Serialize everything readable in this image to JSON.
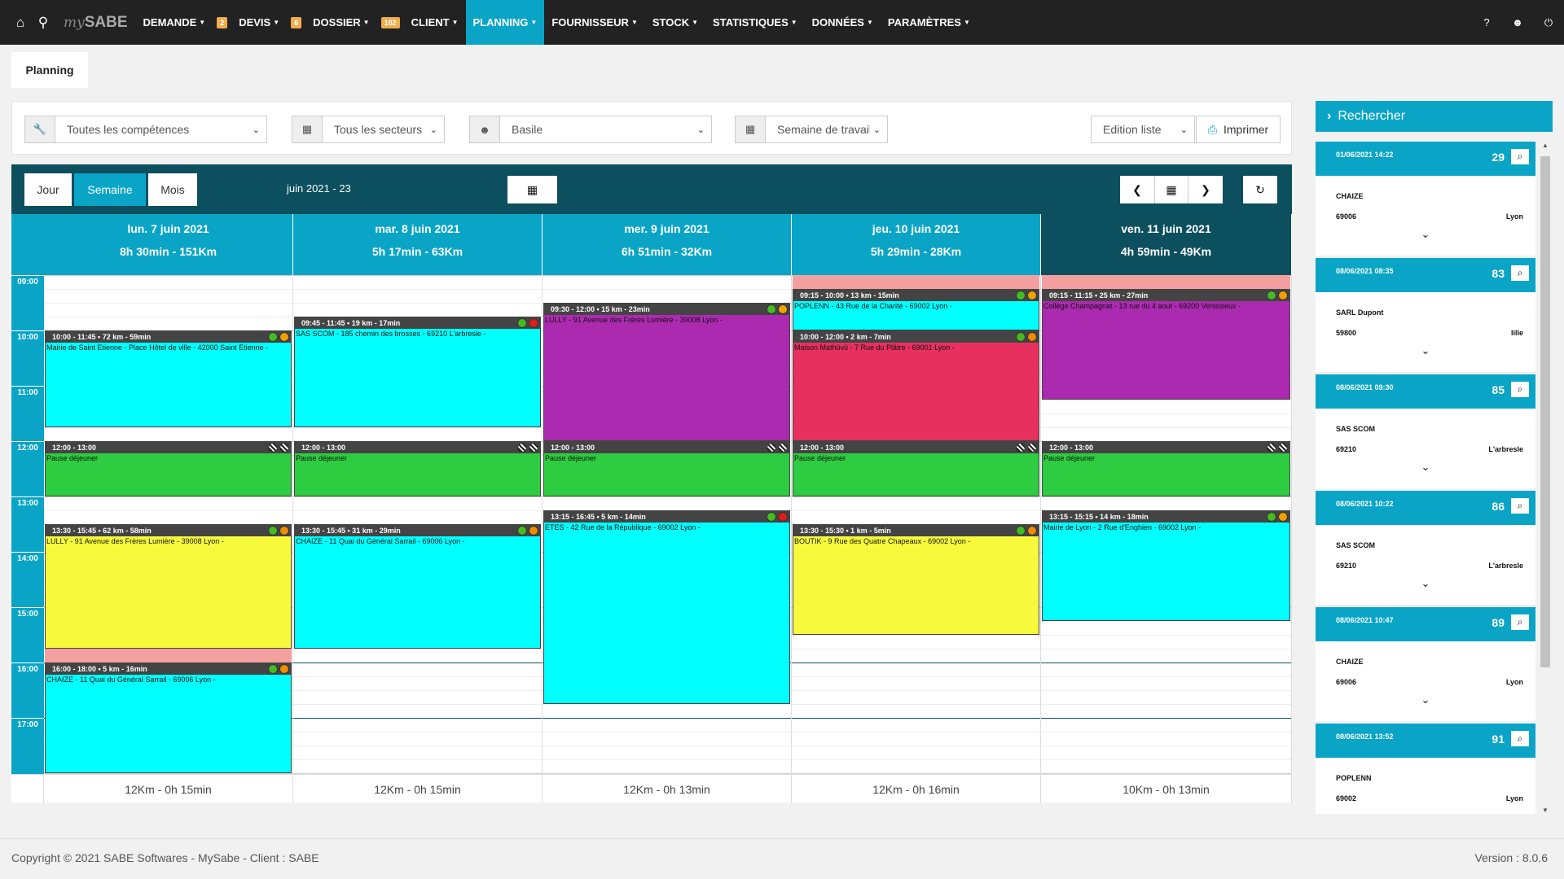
{
  "nav": {
    "logo_prefix": "my",
    "logo_main": "SABE",
    "items": [
      {
        "label": "DEMANDE",
        "badge": "2"
      },
      {
        "label": "DEVIS",
        "badge": "6"
      },
      {
        "label": "DOSSIER",
        "badge": "102"
      },
      {
        "label": "CLIENT",
        "badge": ""
      },
      {
        "label": "PLANNING",
        "badge": "",
        "active": true
      },
      {
        "label": "FOURNISSEUR",
        "badge": ""
      },
      {
        "label": "STOCK",
        "badge": ""
      },
      {
        "label": "STATISTIQUES",
        "badge": ""
      },
      {
        "label": "DONNÉES",
        "badge": ""
      },
      {
        "label": "PARAMÈTRES",
        "badge": ""
      }
    ],
    "right_icons": [
      "help-icon",
      "user-icon",
      "power-icon"
    ],
    "help_label": "?"
  },
  "breadcrumb": "Planning",
  "filters": {
    "competences": "Toutes les compétences",
    "secteurs": "Tous les secteurs",
    "employee": "Basile",
    "period": "Semaine de travail",
    "mode": "Edition liste",
    "print": "Imprimer"
  },
  "toolbar": {
    "views": [
      "Jour",
      "Semaine",
      "Mois"
    ],
    "active_view": "Semaine",
    "title": "juin 2021 - 23"
  },
  "hours": [
    "09:00",
    "10:00",
    "11:00",
    "12:00",
    "13:00",
    "14:00",
    "15:00",
    "16:00",
    "17:00"
  ],
  "days": [
    {
      "name": "lun. 7 juin 2021",
      "summary": "8h 30min - 151Km",
      "footer": "12Km - 0h 15min",
      "color": "#0aa5c6",
      "events": [
        {
          "start": 10.0,
          "end": 11.75,
          "header": "10:00 - 11:45 • 72 km - 59min",
          "body": "Mairie de Saint Etienne - Place Hôtel de ville - 42000 Saint Etienne -",
          "color": "#00ffff",
          "dots": [
            "#44bb22",
            "#f0a000"
          ]
        },
        {
          "start": 12.0,
          "end": 13.0,
          "header": "12:00 - 13:00",
          "body": "Pause déjeuner",
          "color": "#2ecc40",
          "dots": [
            "hatch",
            "hatch"
          ]
        },
        {
          "start": 13.5,
          "end": 15.75,
          "header": "13:30 - 15:45 • 62 km - 58min",
          "body": "LULLY - 91 Avenue des Frères Lumière - 39008 Lyon -",
          "color": "#f7fa3c",
          "dots": [
            "#44bb22",
            "#f08c00"
          ]
        },
        {
          "start": 15.75,
          "end": 16.0,
          "header": "",
          "body": "",
          "color": "#f4a0a0",
          "dots": []
        },
        {
          "start": 16.0,
          "end": 18.0,
          "header": "16:00 - 18:00 • 5 km - 16min",
          "body": "CHAIZE - 11 Quai du Général Sarrail - 69006 Lyon -",
          "color": "#00ffff",
          "dots": [
            "#44bb22",
            "#f08c00"
          ]
        }
      ]
    },
    {
      "name": "mar. 8 juin 2021",
      "summary": "5h 17min - 63Km",
      "footer": "12Km - 0h 15min",
      "color": "#0aa5c6",
      "events": [
        {
          "start": 9.75,
          "end": 11.75,
          "header": "09:45 - 11:45 • 19 km - 17min",
          "body": "SAS SCOM - 185 chemin des brosses - 69210 L'arbresle -",
          "color": "#00ffff",
          "dots": [
            "#44bb22",
            "#e21b1b"
          ]
        },
        {
          "start": 12.0,
          "end": 13.0,
          "header": "12:00 - 13:00",
          "body": "Pause déjeuner",
          "color": "#2ecc40",
          "dots": [
            "hatch",
            "hatch"
          ]
        },
        {
          "start": 13.5,
          "end": 15.75,
          "header": "13:30 - 15:45 • 31 km - 29min",
          "body": "CHAIZE - 11 Quai du Général Sarrail - 69006 Lyon -",
          "color": "#00ffff",
          "dots": [
            "#44bb22",
            "#f08c00"
          ]
        }
      ]
    },
    {
      "name": "mer. 9 juin 2021",
      "summary": "6h 51min - 32Km",
      "footer": "12Km - 0h 13min",
      "color": "#0aa5c6",
      "events": [
        {
          "start": 9.5,
          "end": 12.0,
          "header": "09:30 - 12:00 • 15 km - 23min",
          "body": "LULLY - 91 Avenue des Frères Lumière - 39008 Lyon -",
          "color": "#ac2ab0",
          "dots": [
            "#44bb22",
            "#f0a000"
          ]
        },
        {
          "start": 12.0,
          "end": 13.0,
          "header": "12:00 - 13:00",
          "body": "Pause déjeuner",
          "color": "#2ecc40",
          "dots": [
            "hatch",
            "hatch"
          ]
        },
        {
          "start": 13.25,
          "end": 16.75,
          "header": "13:15 - 16:45 • 5 km - 14min",
          "body": "ETES - 42 Rue de la République - 69002 Lyon -",
          "color": "#00ffff",
          "dots": [
            "#44bb22",
            "#e21b1b"
          ]
        }
      ]
    },
    {
      "name": "jeu. 10 juin 2021",
      "summary": "5h 29min - 28Km",
      "footer": "12Km - 0h 16min",
      "color": "#0aa5c6",
      "events": [
        {
          "start": 9.0,
          "end": 9.25,
          "header": "",
          "body": "",
          "color": "#f4a0a0",
          "dots": []
        },
        {
          "start": 9.25,
          "end": 10.0,
          "header": "09:15 - 10:00 • 13 km - 15min",
          "body": "POPLENN - 43 Rue de la Charité - 69002 Lyon -",
          "color": "#00ffff",
          "dots": [
            "#44bb22",
            "#f0a000"
          ]
        },
        {
          "start": 10.0,
          "end": 12.0,
          "header": "10:00 - 12:00 • 2 km - 7min",
          "body": "Maison Mathûvû - 7 Rue du Plâtre - 69001 Lyon -",
          "color": "#e8305f",
          "dots": [
            "#44bb22",
            "#f08c00"
          ]
        },
        {
          "start": 12.0,
          "end": 13.0,
          "header": "12:00 - 13:00",
          "body": "Pause déjeuner",
          "color": "#2ecc40",
          "dots": [
            "hatch",
            "hatch"
          ]
        },
        {
          "start": 13.5,
          "end": 15.5,
          "header": "13:30 - 15:30 • 1 km - 5min",
          "body": "BOUTIK - 9 Rue des Quatre Chapeaux - 69002 Lyon -",
          "color": "#f7fa3c",
          "dots": [
            "#44bb22",
            "#f08c00"
          ]
        }
      ]
    },
    {
      "name": "ven. 11 juin 2021",
      "summary": "4h 59min - 49Km",
      "footer": "10Km - 0h 13min",
      "color": "#0c4f5f",
      "events": [
        {
          "start": 9.0,
          "end": 9.25,
          "header": "",
          "body": "",
          "color": "#f4a0a0",
          "dots": []
        },
        {
          "start": 9.25,
          "end": 11.25,
          "header": "09:15 - 11:15 • 25 km - 27min",
          "body": "Collège Champagnat - 13 rue du 4 aout - 69200 Venissieux -",
          "color": "#ac2ab0",
          "dots": [
            "#44bb22",
            "#f0a000"
          ]
        },
        {
          "start": 12.0,
          "end": 13.0,
          "header": "12:00 - 13:00",
          "body": "Pause déjeuner",
          "color": "#2ecc40",
          "dots": [
            "hatch",
            "hatch"
          ]
        },
        {
          "start": 13.25,
          "end": 15.25,
          "header": "13:15 - 15:15 • 14 km - 18min",
          "body": "Mairie de Lyon - 2 Rue d'Enghien - 69002 Lyon -",
          "color": "#00ffff",
          "dots": [
            "#44bb22",
            "#f0a000"
          ]
        }
      ]
    }
  ],
  "search": {
    "title": "Rechercher",
    "cards": [
      {
        "date": "01/06/2021 14:22",
        "num": "29",
        "name": "CHAIZE",
        "zip": "69006",
        "city": "Lyon"
      },
      {
        "date": "08/06/2021 08:35",
        "num": "83",
        "name": "SARL Dupont",
        "zip": "59800",
        "city": "lille"
      },
      {
        "date": "08/06/2021 09:30",
        "num": "85",
        "name": "SAS SCOM",
        "zip": "69210",
        "city": "L'arbresle"
      },
      {
        "date": "08/06/2021 10:22",
        "num": "86",
        "name": "SAS SCOM",
        "zip": "69210",
        "city": "L'arbresle"
      },
      {
        "date": "08/06/2021 10:47",
        "num": "89",
        "name": "CHAIZE",
        "zip": "69006",
        "city": "Lyon"
      },
      {
        "date": "08/06/2021 13:52",
        "num": "91",
        "name": "POPLENN",
        "zip": "69002",
        "city": "Lyon"
      }
    ]
  },
  "footer": {
    "copyright": "Copyright © 2021 SABE Softwares - MySabe - Client : SABE",
    "version": "Version : 8.0.6"
  }
}
